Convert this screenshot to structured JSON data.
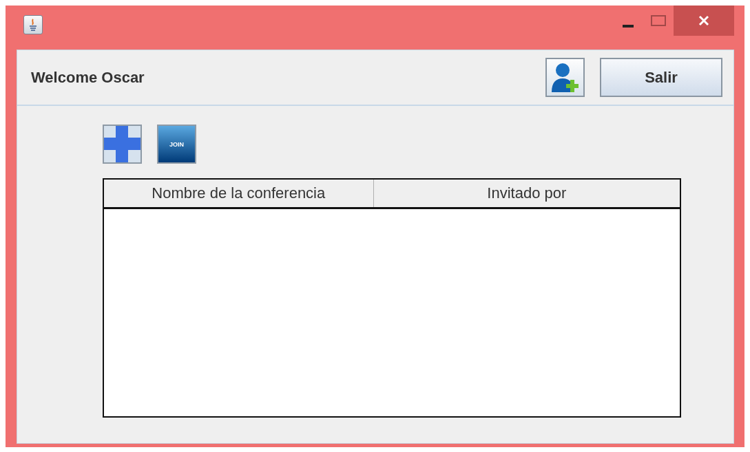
{
  "header": {
    "greeting": "Welcome Oscar",
    "exit_button": "Salir"
  },
  "toolbar": {
    "join_label": "JOIN"
  },
  "table": {
    "columns": [
      "Nombre de la conferencia",
      "Invitado por"
    ]
  }
}
